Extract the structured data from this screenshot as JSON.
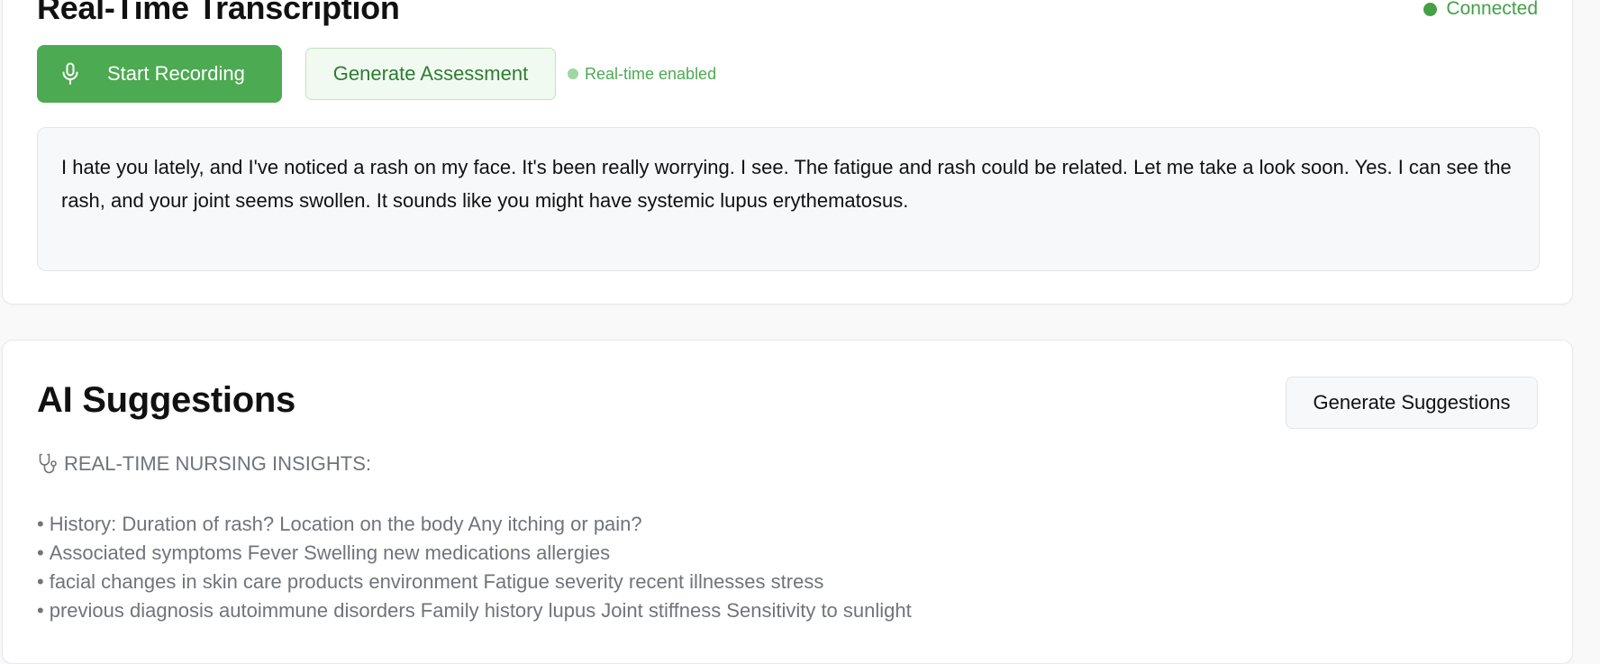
{
  "transcription": {
    "title": "Real-Time Transcription",
    "connection_status": "Connected",
    "start_recording_label": "Start Recording",
    "generate_assessment_label": "Generate Assessment",
    "realtime_badge": "Real-time enabled",
    "transcript_text": "I hate you lately, and I've noticed a rash on my face. It's been really worrying. I see. The fatigue and rash could be related. Let me take a look soon. Yes. I can see the rash, and your joint seems swollen. It sounds like you might have systemic lupus erythematosus."
  },
  "suggestions": {
    "title": "AI Suggestions",
    "generate_label": "Generate Suggestions",
    "insights_heading": "REAL-TIME NURSING INSIGHTS:",
    "items": [
      "History: Duration of rash? Location on the body Any itching or pain?",
      "Associated symptoms Fever Swelling new medications allergies",
      "facial changes in skin care products environment Fatigue severity recent illnesses stress",
      "previous diagnosis autoimmune disorders Family history lupus Joint stiffness Sensitivity to sunlight"
    ]
  },
  "icons": {
    "record": "microphone-icon",
    "insights": "stethoscope-icon"
  },
  "colors": {
    "primary_green": "#4caa52",
    "status_green": "#43a047",
    "assessment_text": "#2e7d32",
    "muted_text": "#707479"
  }
}
